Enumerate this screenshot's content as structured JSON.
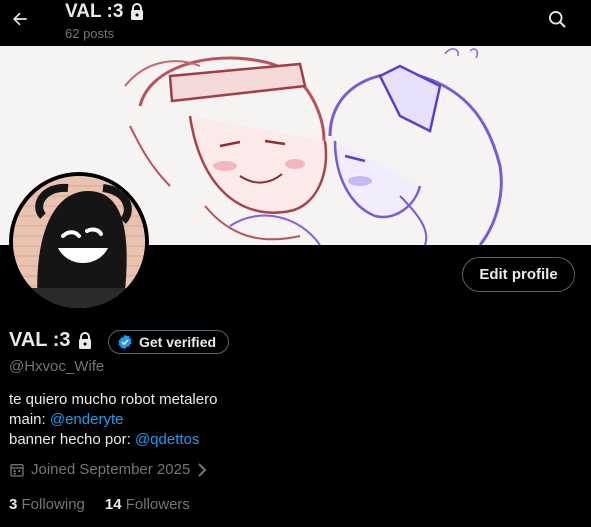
{
  "header": {
    "title": "VAL :3",
    "subtitle": "62 posts"
  },
  "profile": {
    "display_name": "VAL :3",
    "handle": "@Hxvoc_Wife",
    "get_verified_label": "Get verified",
    "edit_profile_label": "Edit profile",
    "bio": {
      "line1": "te quiero mucho robot metalero",
      "line2_prefix": "main: ",
      "line2_link": "@enderyte",
      "line3_prefix": "banner hecho por: ",
      "line3_link": "@qdettos"
    },
    "joined": "Joined September 2025",
    "following_count": "3",
    "following_label": "Following",
    "followers_count": "14",
    "followers_label": "Followers"
  },
  "icons": {
    "back": "arrow-left-icon",
    "search": "search-icon",
    "lock": "lock-icon",
    "verified": "verified-badge-icon",
    "calendar": "calendar-icon",
    "chevron": "chevron-right-icon"
  },
  "colors": {
    "background": "#000000",
    "text_primary": "#e7e9ea",
    "text_secondary": "#71767b",
    "link": "#1d9bf0",
    "border": "#536471"
  }
}
